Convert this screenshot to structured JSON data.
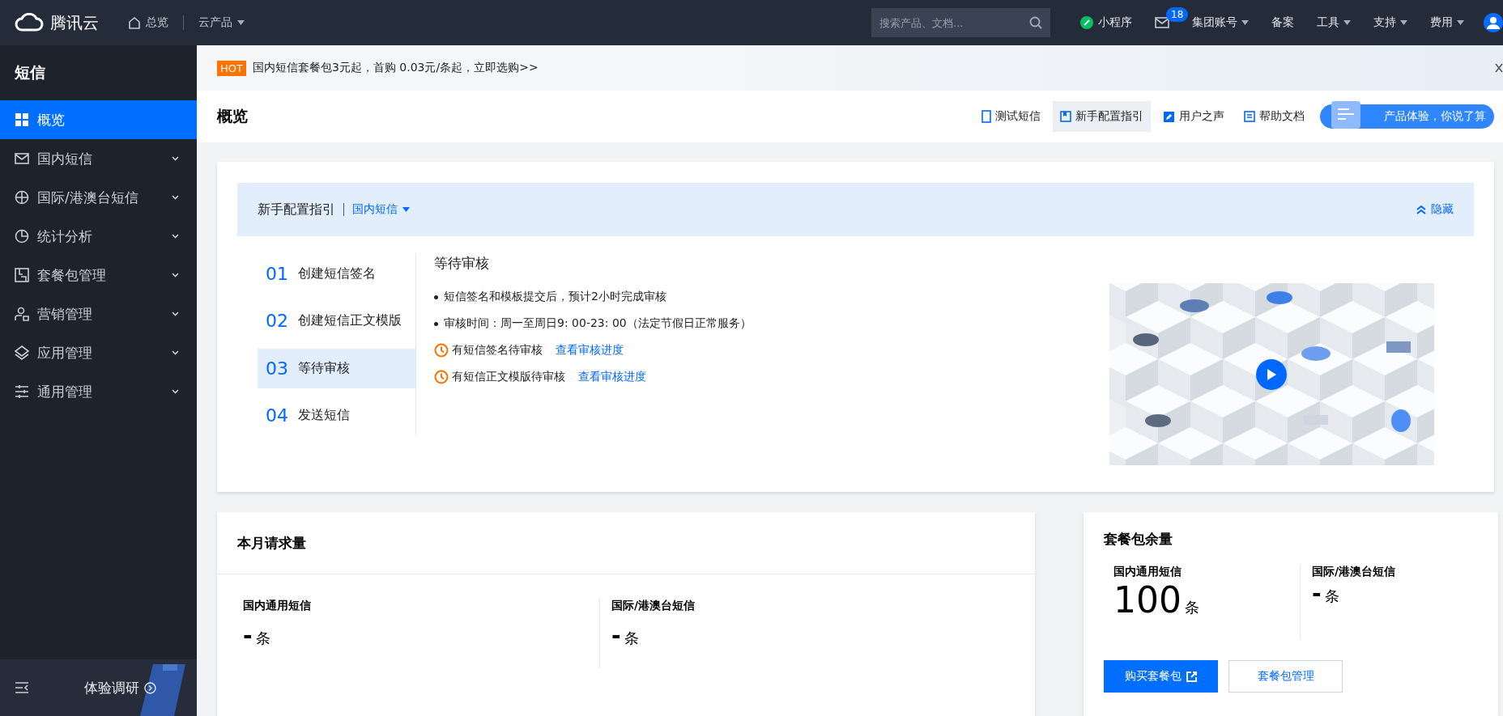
{
  "topbar": {
    "brand": "腾讯云",
    "nav": [
      {
        "label": "总览",
        "dropdown": false
      },
      {
        "label": "云产品",
        "dropdown": true
      }
    ],
    "search": {
      "placeholder": "搜索产品、文档..."
    },
    "right": [
      {
        "kind": "app",
        "label": "小程序"
      },
      {
        "kind": "mail",
        "badge": "18"
      },
      {
        "kind": "link",
        "label": "集团账号",
        "dropdown": true
      },
      {
        "kind": "link",
        "label": "备案",
        "dropdown": false
      },
      {
        "kind": "link",
        "label": "工具",
        "dropdown": true
      },
      {
        "kind": "link",
        "label": "支持",
        "dropdown": true
      },
      {
        "kind": "link",
        "label": "费用",
        "dropdown": true
      },
      {
        "kind": "avatar"
      }
    ]
  },
  "sidebar": {
    "title": "短信",
    "items": [
      {
        "label": "概览",
        "selected": true,
        "submenu": false
      },
      {
        "label": "国内短信",
        "selected": false,
        "submenu": true
      },
      {
        "label": "国际/港澳台短信",
        "selected": false,
        "submenu": true
      },
      {
        "label": "统计分析",
        "selected": false,
        "submenu": true
      },
      {
        "label": "套餐包管理",
        "selected": false,
        "submenu": true
      },
      {
        "label": "营销管理",
        "selected": false,
        "submenu": true
      },
      {
        "label": "应用管理",
        "selected": false,
        "submenu": true
      },
      {
        "label": "通用管理",
        "selected": false,
        "submenu": true
      }
    ],
    "footer": "体验调研"
  },
  "banner": {
    "badge": "HOT",
    "text": "国内短信套餐包3元起，首购 0.03元/条起，立即选购>>"
  },
  "header": {
    "title": "概览",
    "tools": [
      {
        "label": "测试短信",
        "selected": false
      },
      {
        "label": "新手配置指引",
        "selected": true
      },
      {
        "label": "用户之声",
        "selected": false
      },
      {
        "label": "帮助文档",
        "selected": false
      }
    ],
    "feedback": "产品体验，你说了算"
  },
  "guide": {
    "title": "新手配置指引",
    "filter": "国内短信",
    "hide": "隐藏",
    "steps": [
      {
        "number": "01",
        "label": "创建短信签名",
        "selected": false
      },
      {
        "number": "02",
        "label": "创建短信正文模版",
        "selected": false
      },
      {
        "number": "03",
        "label": "等待审核",
        "selected": true
      },
      {
        "number": "04",
        "label": "发送短信",
        "selected": false
      }
    ],
    "detail": {
      "title": "等待审核",
      "bullets": [
        "短信签名和模板提交后，预计2小时完成审核",
        "审核时间：周一至周日9: 00-23: 00（法定节假日正常服务）"
      ],
      "pending": [
        {
          "text": "有短信签名待审核",
          "link": "查看审核进度"
        },
        {
          "text": "有短信正文模版待审核",
          "link": "查看审核进度"
        }
      ]
    }
  },
  "requests": {
    "title": "本月请求量",
    "stats": [
      {
        "label": "国内通用短信",
        "value": "-",
        "unit": "条"
      },
      {
        "label": "国际/港澳台短信",
        "value": "-",
        "unit": "条"
      }
    ]
  },
  "packages": {
    "title": "套餐包余量",
    "stats": [
      {
        "label": "国内通用短信",
        "value": "100",
        "unit": "条"
      },
      {
        "label": "国际/港澳台短信",
        "value": "-",
        "unit": "条"
      }
    ],
    "buttons": [
      {
        "label": "购买套餐包",
        "kind": "primary"
      },
      {
        "label": "套餐包管理",
        "kind": "secondary"
      }
    ]
  }
}
